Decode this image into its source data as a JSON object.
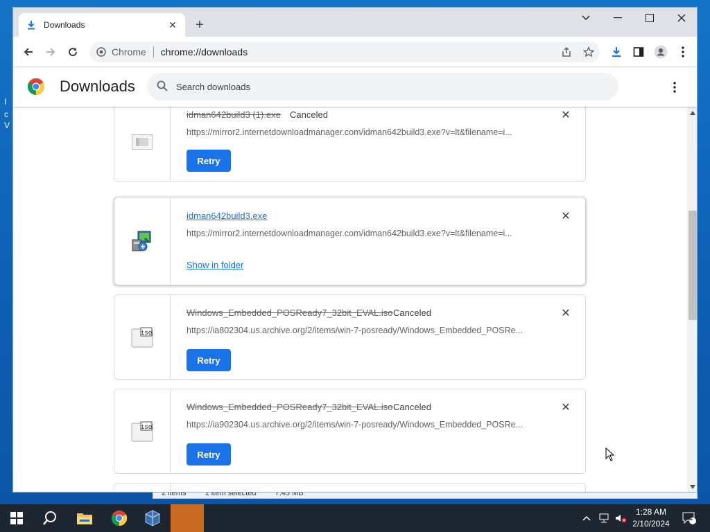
{
  "desktop": {
    "fragments": [
      "I",
      "c",
      "V"
    ]
  },
  "browser": {
    "tab": {
      "title": "Downloads"
    },
    "omnibox": {
      "chip": "Chrome",
      "url": "chrome://downloads"
    }
  },
  "page": {
    "title": "Downloads",
    "search_placeholder": "Search downloads"
  },
  "downloads": [
    {
      "name": "idman642build3 (1).exe",
      "status": "Canceled",
      "url": "https://mirror2.internetdownloadmanager.com/idman642build3.exe?v=lt&filename=i...",
      "action": "Retry",
      "icon": "blank-file-icon"
    },
    {
      "name": "idman642build3.exe",
      "status": "",
      "url": "https://mirror2.internetdownloadmanager.com/idman642build3.exe?v=lt&filename=i...",
      "action": "Show in folder",
      "icon": "installer-icon"
    },
    {
      "name": "Windows_Embedded_POSReady7_32bit_EVAL.iso",
      "status": "Canceled",
      "url": "https://ia802304.us.archive.org/2/items/win-7-posready/Windows_Embedded_POSRe...",
      "action": "Retry",
      "icon": "iso-file-icon"
    },
    {
      "name": "Windows_Embedded_POSReady7_32bit_EVAL.iso",
      "status": "Canceled",
      "url": "https://ia902304.us.archive.org/2/items/win-7-posready/Windows_Embedded_POSRe...",
      "action": "Retry",
      "icon": "iso-file-icon"
    }
  ],
  "behind_window": {
    "items": [
      "2 items",
      "1 item selected",
      "7.45 MB"
    ]
  },
  "taskbar": {
    "time": "1:28 AM",
    "date": "2/10/2024",
    "notification_count": "1"
  },
  "colors": {
    "accent": "#1a73e8",
    "taskbar": "#1e2631",
    "active_app": "#c86a22"
  }
}
